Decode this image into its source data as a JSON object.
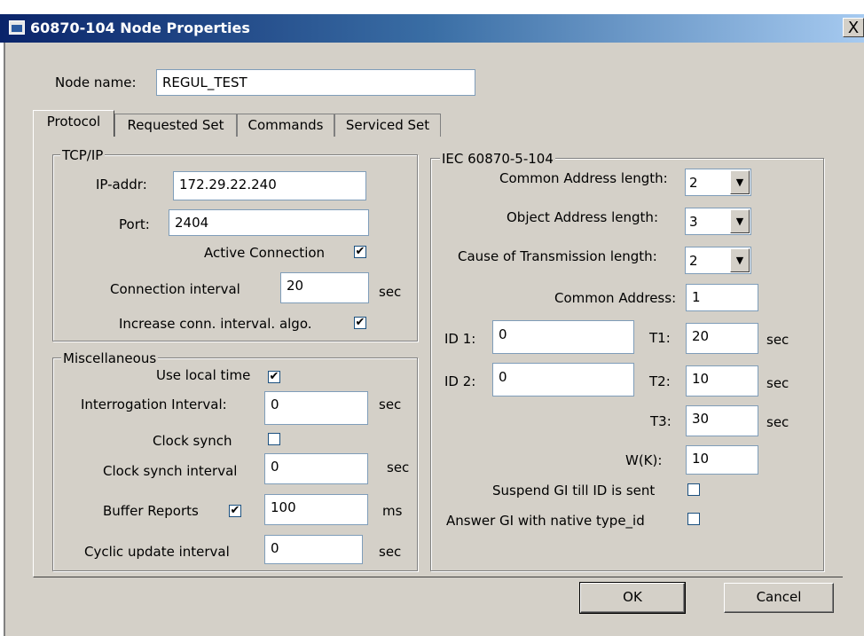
{
  "window": {
    "title": "60870-104 Node Properties",
    "close_glyph": "X"
  },
  "node": {
    "label": "Node name:",
    "value": "REGUL_TEST"
  },
  "tabs": [
    {
      "label": "Protocol"
    },
    {
      "label": "Requested Set"
    },
    {
      "label": "Commands"
    },
    {
      "label": "Serviced Set"
    }
  ],
  "tcpip": {
    "title": "TCP/IP",
    "ip_label": "IP-addr:",
    "ip_value": "172.29.22.240",
    "port_label": "Port:",
    "port_value": "2404",
    "active_label": "Active Connection",
    "active_checked": "✔",
    "conn_interval_label": "Connection interval",
    "conn_interval_value": "20",
    "conn_interval_unit": "sec",
    "increase_label": "Increase conn. interval. algo.",
    "increase_checked": "✔"
  },
  "misc": {
    "title": "Miscellaneous",
    "use_local_label": "Use local time",
    "use_local_checked": "✔",
    "interrogation_label": "Interrogation Interval:",
    "interrogation_value": "0",
    "interrogation_unit": "sec",
    "clock_synch_label": "Clock synch",
    "clock_synch_checked": "",
    "clock_interval_label": "Clock synch interval",
    "clock_interval_value": "0",
    "clock_interval_unit": "sec",
    "buffer_label": "Buffer Reports",
    "buffer_checked": "✔",
    "buffer_value": "100",
    "buffer_unit": "ms",
    "cyclic_label": "Cyclic update interval",
    "cyclic_value": "0",
    "cyclic_unit": "sec"
  },
  "iec": {
    "title": "IEC 60870-5-104",
    "common_len_label": "Common Address length:",
    "common_len_value": "2",
    "object_len_label": "Object Address length:",
    "object_len_value": "3",
    "cot_len_label": "Cause of Transmission length:",
    "cot_len_value": "2",
    "common_addr_label": "Common Address:",
    "common_addr_value": "1",
    "id1_label": "ID 1:",
    "id1_value": "0",
    "t1_label": "T1:",
    "t1_value": "20",
    "t1_unit": "sec",
    "id2_label": "ID 2:",
    "id2_value": "0",
    "t2_label": "T2:",
    "t2_value": "10",
    "t2_unit": "sec",
    "t3_label": "T3:",
    "t3_value": "30",
    "t3_unit": "sec",
    "wk_label": "W(K):",
    "wk_value": "10",
    "suspend_label": "Suspend GI till ID is sent",
    "suspend_checked": "",
    "answer_label": "Answer GI with native type_id",
    "answer_checked": ""
  },
  "buttons": {
    "ok": "OK",
    "cancel": "Cancel"
  },
  "icons": {
    "title_icon": "window-app-icon",
    "close_icon": "close-icon",
    "dropdown_icon": "chevron-down-icon",
    "check_icon": "checkmark-icon"
  }
}
